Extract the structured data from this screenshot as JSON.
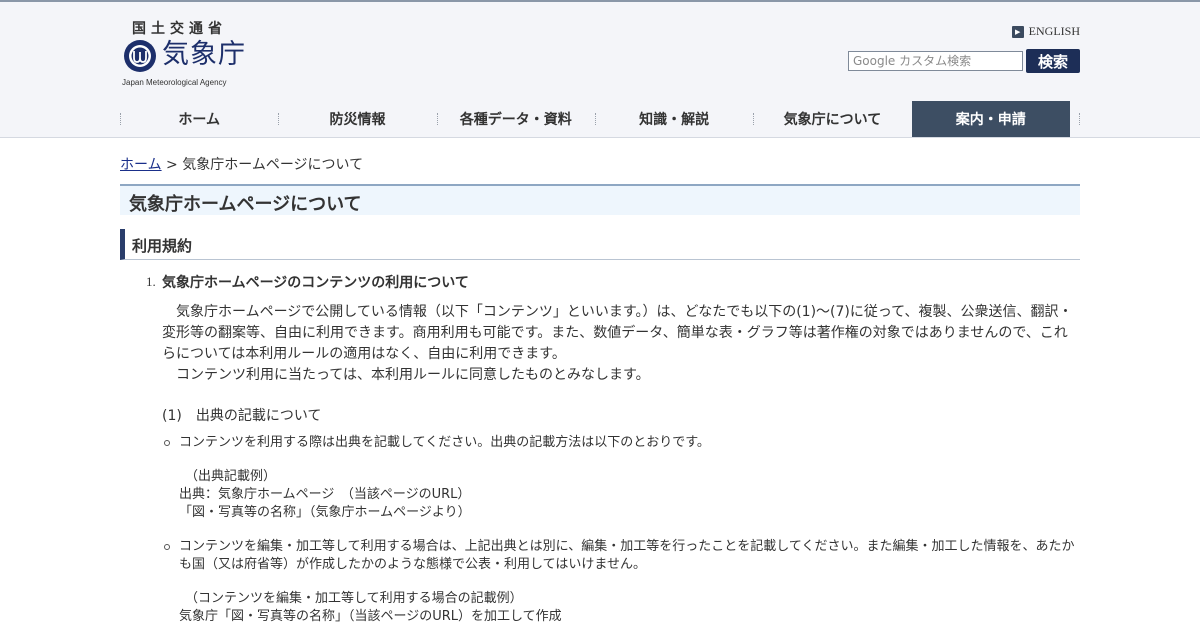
{
  "header": {
    "ministry": "国土交通省",
    "agency_name": "気象庁",
    "agency_name_en": "Japan Meteorological Agency",
    "english_link": "ENGLISH",
    "search_placeholder": "Google カスタム検索",
    "search_button": "検索"
  },
  "nav": {
    "items": [
      {
        "label": "ホーム"
      },
      {
        "label": "防災情報"
      },
      {
        "label": "各種データ・資料"
      },
      {
        "label": "知識・解説"
      },
      {
        "label": "気象庁について"
      },
      {
        "label": "案内・申請"
      }
    ]
  },
  "breadcrumb": {
    "home": "ホーム",
    "separator": ">",
    "current": "気象庁ホームページについて"
  },
  "page_title": "気象庁ホームページについて",
  "section_title": "利用規約",
  "content": {
    "item_number": "1.",
    "item_title": "気象庁ホームページのコンテンツの利用について",
    "intro": "気象庁ホームページで公開している情報（以下「コンテンツ」といいます。）は、どなたでも以下の(1)～(7)に従って、複製、公衆送信、翻訳・変形等の翻案等、自由に利用できます。商用利用も可能です。また、数値データ、簡単な表・グラフ等は著作権の対象ではありませんので、これらについては本利用ルールの適用はなく、自由に利用できます。",
    "intro2": "コンテンツ利用に当たっては、本利用ルールに同意したものとみなします。",
    "subsection": "(1)　出典の記載について",
    "bullet1": "コンテンツを利用する際は出典を記載してください。出典の記載方法は以下のとおりです。",
    "example1": {
      "title": "（出典記載例）",
      "line1": "出典：気象庁ホームページ　（当該ページのURL）",
      "line2": "「図・写真等の名称」（気象庁ホームページより）"
    },
    "bullet2": "コンテンツを編集・加工等して利用する場合は、上記出典とは別に、編集・加工等を行ったことを記載してください。また編集・加工した情報を、あたかも国（又は府省等）が作成したかのような態様で公表・利用してはいけません。",
    "example2": {
      "title": "（コンテンツを編集・加工等して利用する場合の記載例）",
      "line1": "気象庁「図・写真等の名称」（当該ページのURL）を加工して作成"
    }
  },
  "colors": {
    "brand": "#1d2f6b",
    "nav_active": "#3d4e63",
    "search_button": "#1d2e57",
    "title_bg": "#eef6fd"
  }
}
